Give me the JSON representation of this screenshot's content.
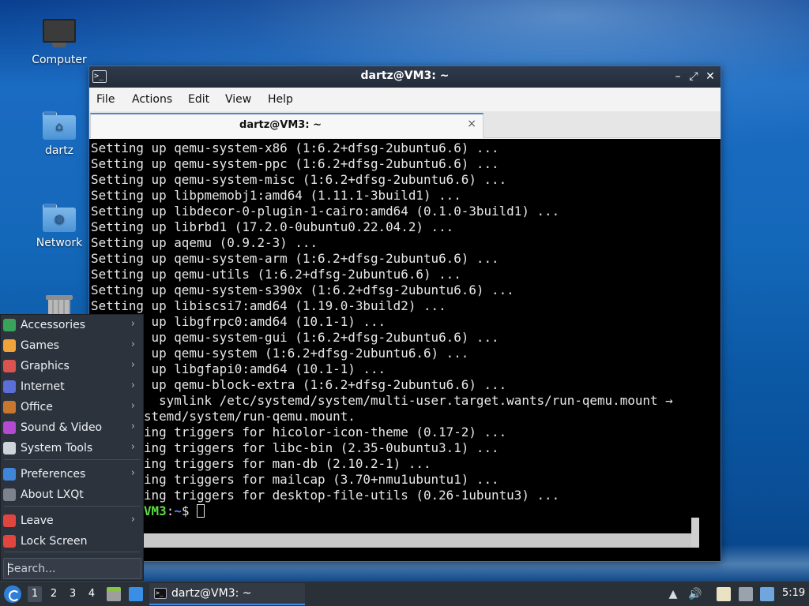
{
  "desktop": {
    "icons": [
      {
        "label": "Computer"
      },
      {
        "label": "dartz"
      },
      {
        "label": "Network"
      }
    ]
  },
  "window": {
    "title": "dartz@VM3: ~",
    "menu": [
      "File",
      "Actions",
      "Edit",
      "View",
      "Help"
    ],
    "tab_label": "dartz@VM3: ~",
    "tab_close": "×",
    "controls": {
      "minimize": "–",
      "maximize": "⤢",
      "close": "✕"
    }
  },
  "terminal": {
    "lines": [
      "Setting up qemu-system-x86 (1:6.2+dfsg-2ubuntu6.6) ...",
      "Setting up qemu-system-ppc (1:6.2+dfsg-2ubuntu6.6) ...",
      "Setting up qemu-system-misc (1:6.2+dfsg-2ubuntu6.6) ...",
      "Setting up libpmemobj1:amd64 (1.11.1-3build1) ...",
      "Setting up libdecor-0-plugin-1-cairo:amd64 (0.1.0-3build1) ...",
      "Setting up librbd1 (17.2.0-0ubuntu0.22.04.2) ...",
      "Setting up aqemu (0.9.2-3) ...",
      "Setting up qemu-system-arm (1:6.2+dfsg-2ubuntu6.6) ...",
      "Setting up qemu-utils (1:6.2+dfsg-2ubuntu6.6) ...",
      "Setting up qemu-system-s390x (1:6.2+dfsg-2ubuntu6.6) ...",
      "Setting up libiscsi7:amd64 (1.19.0-3build2) ...",
      "        up libgfrpc0:amd64 (10.1-1) ...",
      "        up qemu-system-gui (1:6.2+dfsg-2ubuntu6.6) ...",
      "        up qemu-system (1:6.2+dfsg-2ubuntu6.6) ...",
      "        up libgfapi0:amd64 (10.1-1) ...",
      "        up qemu-block-extra (1:6.2+dfsg-2ubuntu6.6) ...",
      "         symlink /etc/systemd/system/multi-user.target.wants/run-qemu.mount →",
      "       stemd/system/run-qemu.mount.",
      "       ing triggers for hicolor-icon-theme (0.17-2) ...",
      "       ing triggers for libc-bin (2.35-0ubuntu3.1) ...",
      "       ing triggers for man-db (2.10.2-1) ...",
      "       ing triggers for mailcap (3.70+nmu1ubuntu1) ...",
      "       ing triggers for desktop-file-utils (0.26-1ubuntu3) ..."
    ],
    "prompt_host": "VM3",
    "prompt_sep": ":",
    "prompt_path": "~",
    "prompt_dollar": "$ "
  },
  "app_menu": {
    "items": [
      {
        "label": "Accessories",
        "icon": "accessories-icon",
        "color": "#3aa35b"
      },
      {
        "label": "Games",
        "icon": "games-icon",
        "color": "#f0a33a"
      },
      {
        "label": "Graphics",
        "icon": "graphics-icon",
        "color": "#d9534f"
      },
      {
        "label": "Internet",
        "icon": "internet-icon",
        "color": "#5b6fd6"
      },
      {
        "label": "Office",
        "icon": "office-icon",
        "color": "#c9772e"
      },
      {
        "label": "Sound & Video",
        "icon": "sound-video-icon",
        "color": "#b44ad0"
      },
      {
        "label": "System Tools",
        "icon": "system-tools-icon",
        "color": "#cfd4da"
      },
      {
        "label": "Preferences",
        "icon": "preferences-icon",
        "color": "#3f86d8"
      },
      {
        "label": "About LXQt",
        "icon": "about-icon",
        "color": "#7c838c"
      },
      {
        "label": "Leave",
        "icon": "leave-icon",
        "color": "#e0463f"
      },
      {
        "label": "Lock Screen",
        "icon": "lock-icon",
        "color": "#e0463f"
      }
    ],
    "search_placeholder": "Search..."
  },
  "taskbar": {
    "desktops": [
      "1",
      "2",
      "3",
      "4"
    ],
    "task_label": "dartz@VM3: ~",
    "clock": "5:19"
  }
}
